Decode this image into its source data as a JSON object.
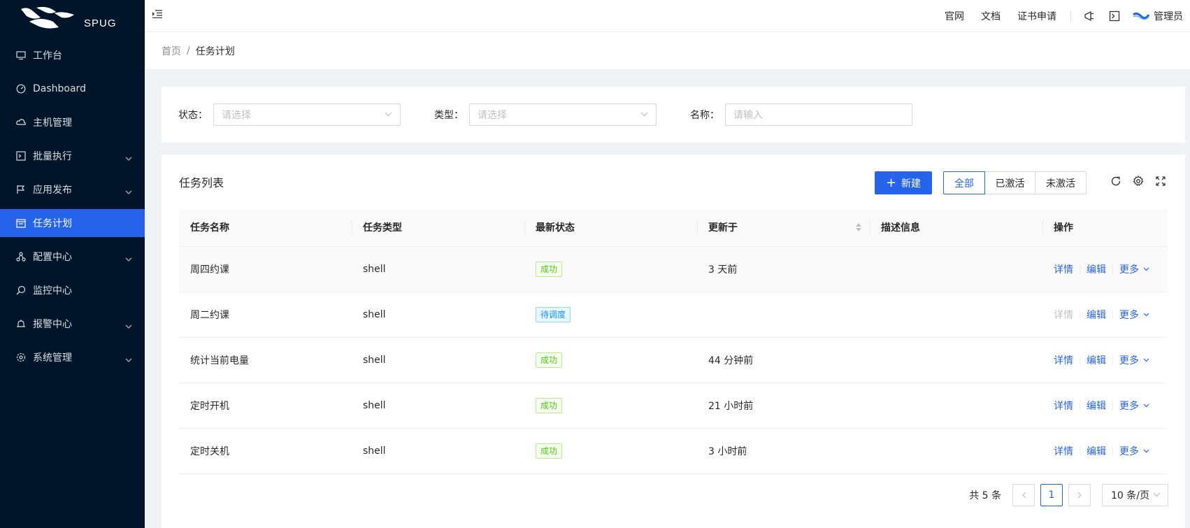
{
  "brand": {
    "name": "SPUG"
  },
  "sidebar": {
    "items": [
      {
        "label": "工作台",
        "icon": "desktop-icon"
      },
      {
        "label": "Dashboard",
        "icon": "dashboard-icon"
      },
      {
        "label": "主机管理",
        "icon": "cloud-server-icon"
      },
      {
        "label": "批量执行",
        "icon": "code-icon",
        "submenu": true
      },
      {
        "label": "应用发布",
        "icon": "flag-icon",
        "submenu": true
      },
      {
        "label": "任务计划",
        "icon": "schedule-icon",
        "active": true
      },
      {
        "label": "配置中心",
        "icon": "deployment-icon",
        "submenu": true
      },
      {
        "label": "监控中心",
        "icon": "monitor-icon"
      },
      {
        "label": "报警中心",
        "icon": "alert-icon",
        "submenu": true
      },
      {
        "label": "系统管理",
        "icon": "setting-icon",
        "submenu": true
      }
    ]
  },
  "header": {
    "links": [
      "官网",
      "文档",
      "证书申请"
    ],
    "user": "管理员"
  },
  "breadcrumb": {
    "home": "首页",
    "sep": "/",
    "current": "任务计划"
  },
  "filters": {
    "status_label": "状态：",
    "status_placeholder": "请选择",
    "type_label": "类型：",
    "type_placeholder": "请选择",
    "name_label": "名称：",
    "name_placeholder": "请输入"
  },
  "table_card": {
    "title": "任务列表",
    "new_button": "新建",
    "plus": "+",
    "radio": [
      "全部",
      "已激活",
      "未激活"
    ],
    "columns": [
      "任务名称",
      "任务类型",
      "最新状态",
      "更新于",
      "描述信息",
      "操作"
    ],
    "rows": [
      {
        "name": "周四约课",
        "type": "shell",
        "status": "成功",
        "status_kind": "success",
        "updated": "3 天前",
        "desc": "",
        "detail_enabled": true
      },
      {
        "name": "周二约课",
        "type": "shell",
        "status": "待调度",
        "status_kind": "pending",
        "updated": "",
        "desc": "",
        "detail_enabled": false
      },
      {
        "name": "统计当前电量",
        "type": "shell",
        "status": "成功",
        "status_kind": "success",
        "updated": "44 分钟前",
        "desc": "",
        "detail_enabled": true
      },
      {
        "name": "定时开机",
        "type": "shell",
        "status": "成功",
        "status_kind": "success",
        "updated": "21 小时前",
        "desc": "",
        "detail_enabled": true
      },
      {
        "name": "定时关机",
        "type": "shell",
        "status": "成功",
        "status_kind": "success",
        "updated": "3 小时前",
        "desc": "",
        "detail_enabled": true
      }
    ],
    "ops": {
      "detail": "详情",
      "edit": "编辑",
      "more": "更多"
    }
  },
  "pagination": {
    "total": "共 5 条",
    "current": "1",
    "page_size": "10 条/页"
  },
  "colors": {
    "primary": "#2563eb",
    "sidebar_bg": "#001529",
    "success": "#52c41a",
    "pending": "#1890ff"
  }
}
